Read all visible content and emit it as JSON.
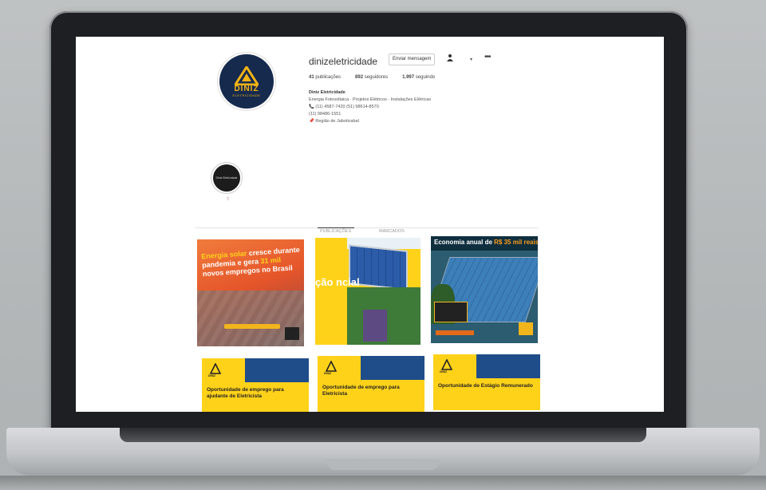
{
  "profile": {
    "username": "dinizeletricidade",
    "send_message": "Enviar mensagem",
    "logo_name": "DINIZ",
    "logo_sub": "ELETRICIDADE",
    "posts_count": "41",
    "posts_label": "publicações",
    "followers_count": "892",
    "followers_label": "seguidores",
    "following_count": "1.997",
    "following_label": "seguindo",
    "bio_name": "Diniz Eletricidade",
    "bio_line1": "Energia Fotovoltaica · Projetos Elétricos · Instalações Elétricas",
    "bio_line2": "(11) 4587-7420 (51) 98614-8570",
    "bio_line3": "(11) 98486-1551",
    "bio_line4": "Região de Jaboticabal"
  },
  "highlight": {
    "label": "Diniz Eletricidade",
    "caption": "Diniz"
  },
  "tabs": {
    "posts": "PUBLICAÇÕES",
    "tagged": "MARCADOS"
  },
  "posts": {
    "p1_pre": "Energia solar",
    "p1_main": " cresce durante pandemia e gera ",
    "p1_num": "31 mil",
    "p1_tail": " novos empregos no Brasil",
    "p2_text": "ção ncial",
    "p3_pre": "Economia anual de ",
    "p3_value": "R$ 35 mil reais",
    "c1_title": "Oportunidade de emprego para ajudante de Eletricista",
    "c2_title": "Oportunidade de emprego para Eletricista",
    "c3_title": "Oportunidade de Estágio Remunerado",
    "card_brand": "DINIZ"
  },
  "colors": {
    "brand_yellow": "#ffd21a",
    "brand_navy": "#162a4e",
    "accent_orange": "#e5552a"
  }
}
